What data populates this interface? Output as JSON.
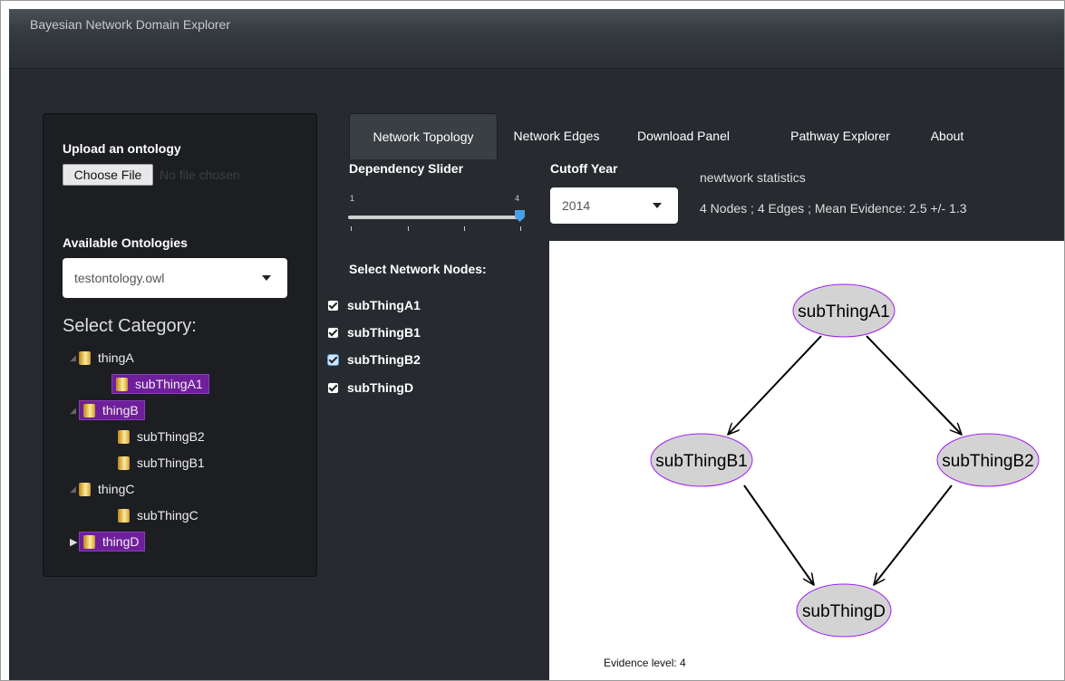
{
  "app": {
    "title": "Bayesian Network Domain Explorer"
  },
  "sidebar": {
    "upload_label": "Upload an ontology",
    "choose_file_button": "Choose File",
    "no_file_text": "No file chosen",
    "ontologies_label": "Available Ontologies",
    "ontology_selected": "testontology.owl",
    "category_label": "Select Category:",
    "tree": [
      {
        "label": "thingA",
        "expanded": true,
        "highlighted": false,
        "children": [
          {
            "label": "subThingA1",
            "highlighted": true
          }
        ]
      },
      {
        "label": "thingB",
        "expanded": true,
        "highlighted": true,
        "children": [
          {
            "label": "subThingB2",
            "highlighted": false
          },
          {
            "label": "subThingB1",
            "highlighted": false
          }
        ]
      },
      {
        "label": "thingC",
        "expanded": true,
        "highlighted": false,
        "children": [
          {
            "label": "subThingC",
            "highlighted": false
          }
        ]
      },
      {
        "label": "thingD",
        "expanded": false,
        "highlighted": true,
        "children": []
      }
    ]
  },
  "tabs": [
    "Network Topology",
    "Network Edges",
    "Download Panel",
    "Pathway Explorer",
    "About"
  ],
  "active_tab": "Network Topology",
  "controls": {
    "dependency_label": "Dependency Slider",
    "slider_min": "1",
    "slider_max": "4",
    "slider_value": 4,
    "cutoff_label": "Cutoff Year",
    "cutoff_value": "2014",
    "stats_title": "newtwork statistics",
    "stats_text": "4 Nodes ; 4 Edges ; Mean Evidence: 2.5 +/- 1.3",
    "nodes_label": "Select Network Nodes:",
    "nodes": [
      {
        "label": "subThingA1",
        "checked": true
      },
      {
        "label": "subThingB1",
        "checked": true
      },
      {
        "label": "subThingB2",
        "checked": true
      },
      {
        "label": "subThingD",
        "checked": true
      }
    ]
  },
  "graph": {
    "nodes": [
      "subThingA1",
      "subThingB1",
      "subThingB2",
      "subThingD"
    ],
    "edges": [
      [
        "subThingA1",
        "subThingB1"
      ],
      [
        "subThingA1",
        "subThingB2"
      ],
      [
        "subThingB1",
        "subThingD"
      ],
      [
        "subThingB2",
        "subThingD"
      ]
    ],
    "evidence_label": "Evidence level:  4",
    "node_fill": "#d3d3d3",
    "node_border": "#a020f0"
  },
  "colors": {
    "background": "#272b30",
    "sidebar": "#1c1e22",
    "highlight": "#6f1f9c",
    "slider": "#4aa0e6"
  }
}
